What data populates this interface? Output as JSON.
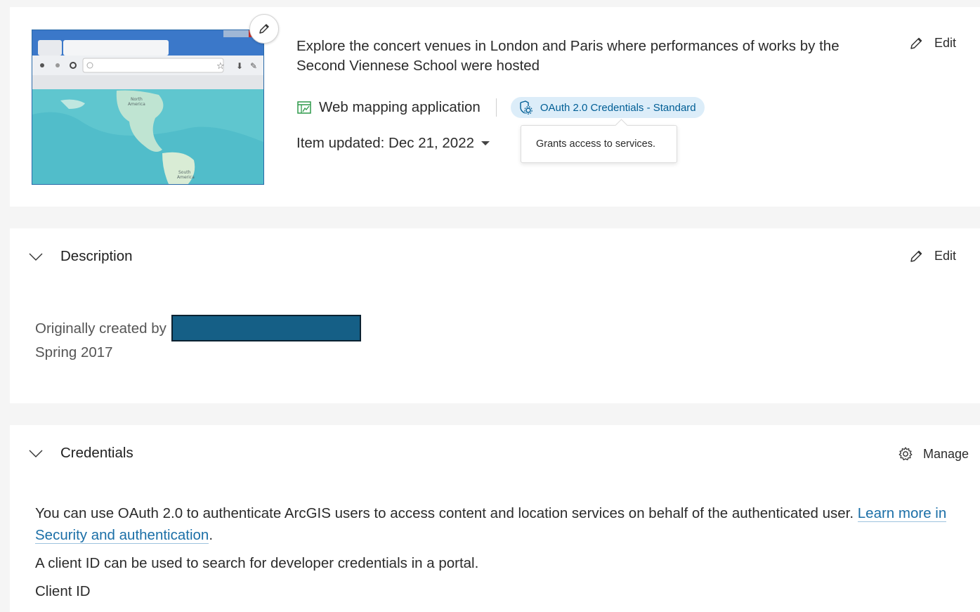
{
  "overview": {
    "summary": "Explore the concert venues in London and Paris where performances of works by the Second Viennese School were hosted",
    "edit_label": "Edit",
    "item_type": "Web mapping application",
    "badge_label": "OAuth 2.0 Credentials - Standard",
    "tooltip": "Grants access to services.",
    "updated": "Item updated: Dec 21, 2022",
    "thumbnail": {
      "map_label_north": "North America",
      "map_label_south": "South America"
    }
  },
  "description": {
    "title": "Description",
    "edit_label": "Edit",
    "line1": "Originally created by",
    "line2": "Spring 2017"
  },
  "credentials": {
    "title": "Credentials",
    "manage_label": "Manage",
    "intro": "You can use OAuth 2.0 to authenticate ArcGIS users to access content and location services on behalf of the authenticated user.",
    "link_text": "Learn more in Security and authentication",
    "intro_end": ".",
    "client_id_note": "A client ID can be used to search for developer credentials in a portal.",
    "client_id_label": "Client ID"
  },
  "colors": {
    "accent": "#005e95",
    "badge_bg": "#dcedf9",
    "type_icon": "#2e9a4a",
    "redaction": "#155f86"
  },
  "icons": {
    "thumbnail_edit": "pencil-icon",
    "edit": "pencil-icon",
    "type": "web-map-app-icon",
    "badge": "credentials-gear-icon",
    "collapse": "chevron-down-icon",
    "manage": "gear-icon",
    "dropdown": "caret-down-icon"
  }
}
